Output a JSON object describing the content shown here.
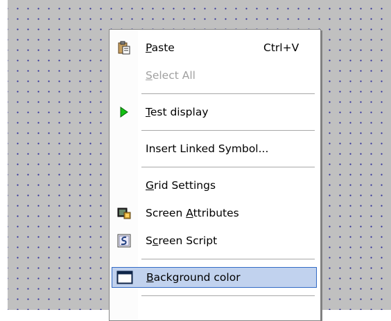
{
  "menu": {
    "paste": {
      "pre": "",
      "key": "P",
      "post": "aste",
      "shortcut": "Ctrl+V",
      "icon": "paste-icon"
    },
    "select_all": {
      "pre": "",
      "key": "S",
      "post": "elect All",
      "icon": "none"
    },
    "test_display": {
      "pre": "",
      "key": "T",
      "post": "est display",
      "icon": "play-icon"
    },
    "insert_linked_symbol": {
      "pre": "Insert Linked Symbol...",
      "key": "",
      "post": "",
      "icon": "none"
    },
    "grid_settings": {
      "pre": "",
      "key": "G",
      "post": "rid Settings",
      "icon": "none"
    },
    "screen_attributes": {
      "pre": "Screen ",
      "key": "A",
      "post": "ttributes",
      "icon": "screen-attributes-icon"
    },
    "screen_script": {
      "pre": "S",
      "key": "c",
      "post": "reen Script",
      "icon": "script-icon"
    },
    "background_color": {
      "pre": "",
      "key": "B",
      "post": "ackground color",
      "icon": "window-icon"
    }
  },
  "colors": {
    "canvas": "#c0c0c0",
    "grid_dot": "#2d2d9a",
    "selection_fill": "#c1d2ee",
    "selection_border": "#316ac5",
    "disabled_text": "#a0a0a0"
  }
}
